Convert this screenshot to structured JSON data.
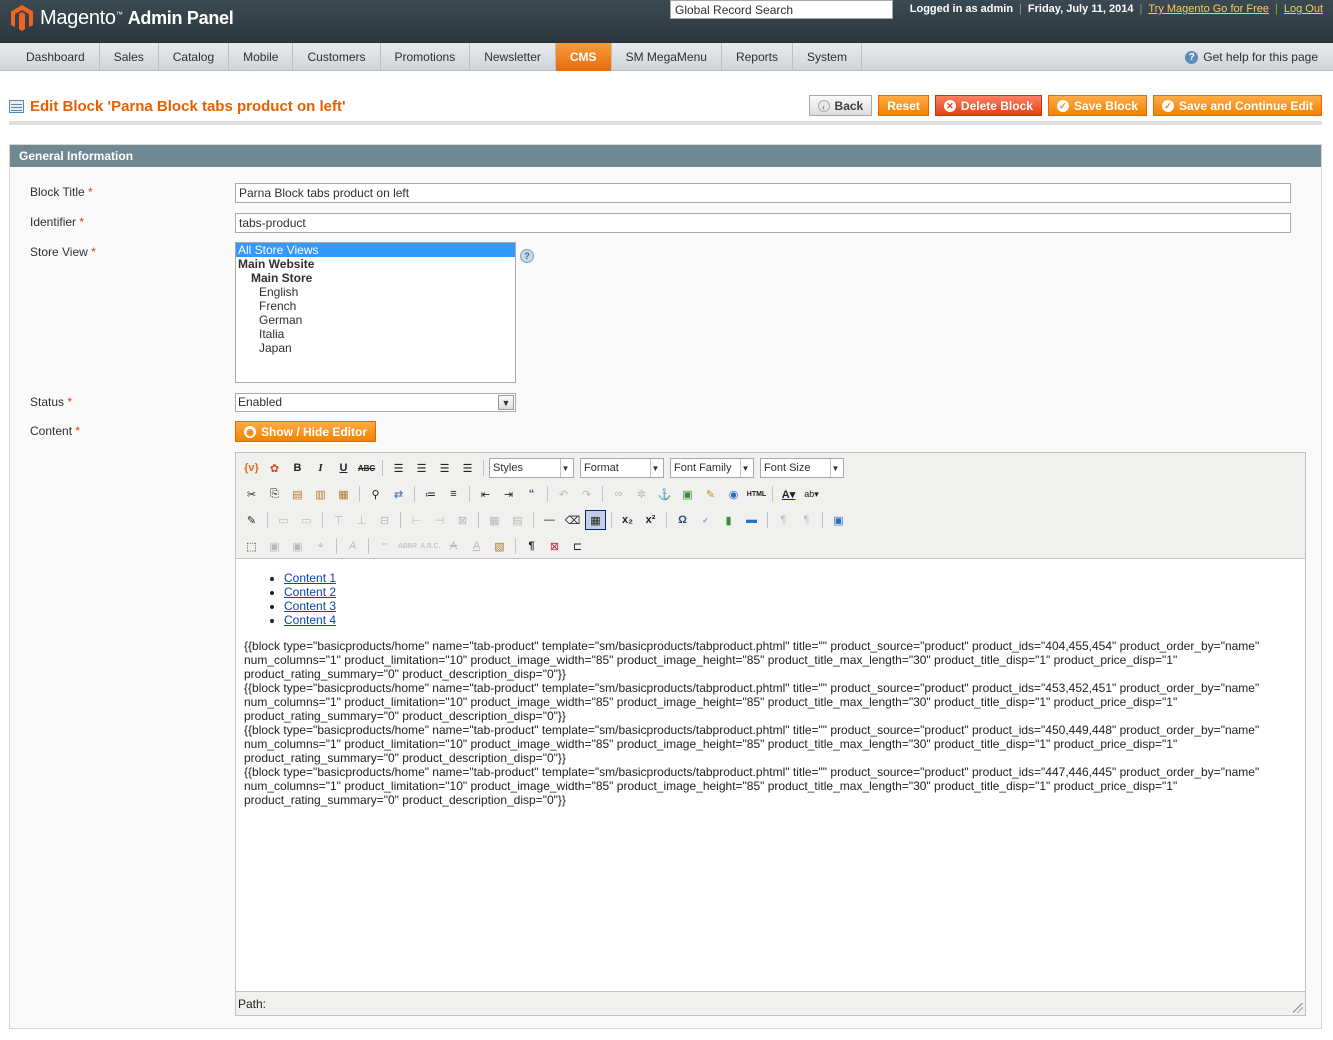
{
  "header": {
    "logo_brand": "Magento",
    "logo_suffix": "Admin Panel",
    "search_placeholder": "Global Record Search",
    "logged_in": "Logged in as admin",
    "date": "Friday, July 11, 2014",
    "try_link": "Try Magento Go for Free",
    "logout": "Log Out"
  },
  "nav": {
    "items": [
      "Dashboard",
      "Sales",
      "Catalog",
      "Mobile",
      "Customers",
      "Promotions",
      "Newsletter",
      "CMS",
      "SM MegaMenu",
      "Reports",
      "System"
    ],
    "active": "CMS",
    "help": "Get help for this page"
  },
  "page": {
    "title": "Edit Block 'Parna Block tabs product on left'",
    "buttons": {
      "back": "Back",
      "reset": "Reset",
      "delete": "Delete Block",
      "save": "Save Block",
      "save_continue": "Save and Continue Edit"
    }
  },
  "form": {
    "legend": "General Information",
    "required_mark": "*",
    "block_title_label": "Block Title",
    "block_title_value": "Parna Block tabs product on left",
    "identifier_label": "Identifier",
    "identifier_value": "tabs-product",
    "store_view_label": "Store View",
    "store_options": [
      "All Store Views",
      "Main Website",
      "Main Store",
      "English",
      "French",
      "German",
      "Italia",
      "Japan"
    ],
    "status_label": "Status",
    "status_value": "Enabled",
    "content_label": "Content",
    "toggle_editor": "Show / Hide Editor"
  },
  "editor": {
    "styles": "Styles",
    "format": "Format",
    "font_family": "Font Family",
    "font_size": "Font Size",
    "links": [
      "Content 1",
      "Content 2",
      "Content 3",
      "Content 4"
    ],
    "blocks": [
      "{{block type=\"basicproducts/home\" name=\"tab-product\" template=\"sm/basicproducts/tabproduct.phtml\" title=\"\" product_source=\"product\" product_ids=\"404,455,454\" product_order_by=\"name\" num_columns=\"1\" product_limitation=\"10\" product_image_width=\"85\" product_image_height=\"85\" product_title_max_length=\"30\" product_title_disp=\"1\" product_price_disp=\"1\" product_rating_summary=\"0\" product_description_disp=\"0\"}}",
      "{{block type=\"basicproducts/home\" name=\"tab-product\" template=\"sm/basicproducts/tabproduct.phtml\" title=\"\" product_source=\"product\" product_ids=\"453,452,451\" product_order_by=\"name\" num_columns=\"1\" product_limitation=\"10\" product_image_width=\"85\" product_image_height=\"85\" product_title_max_length=\"30\" product_title_disp=\"1\" product_price_disp=\"1\" product_rating_summary=\"0\" product_description_disp=\"0\"}}",
      "{{block type=\"basicproducts/home\" name=\"tab-product\" template=\"sm/basicproducts/tabproduct.phtml\" title=\"\" product_source=\"product\" product_ids=\"450,449,448\" product_order_by=\"name\" num_columns=\"1\" product_limitation=\"10\" product_image_width=\"85\" product_image_height=\"85\" product_title_max_length=\"30\" product_title_disp=\"1\" product_price_disp=\"1\" product_rating_summary=\"0\" product_description_disp=\"0\"}}",
      "{{block type=\"basicproducts/home\" name=\"tab-product\" template=\"sm/basicproducts/tabproduct.phtml\" title=\"\" product_source=\"product\" product_ids=\"447,446,445\" product_order_by=\"name\" num_columns=\"1\" product_limitation=\"10\" product_image_width=\"85\" product_image_height=\"85\" product_title_max_length=\"30\" product_title_disp=\"1\" product_price_disp=\"1\" product_rating_summary=\"0\" product_description_disp=\"0\"}}"
    ],
    "path_label": "Path:"
  },
  "colors": {
    "accent": "#eb5e00",
    "legend_bg": "#6f8992",
    "header_bg": "#2b363c"
  }
}
